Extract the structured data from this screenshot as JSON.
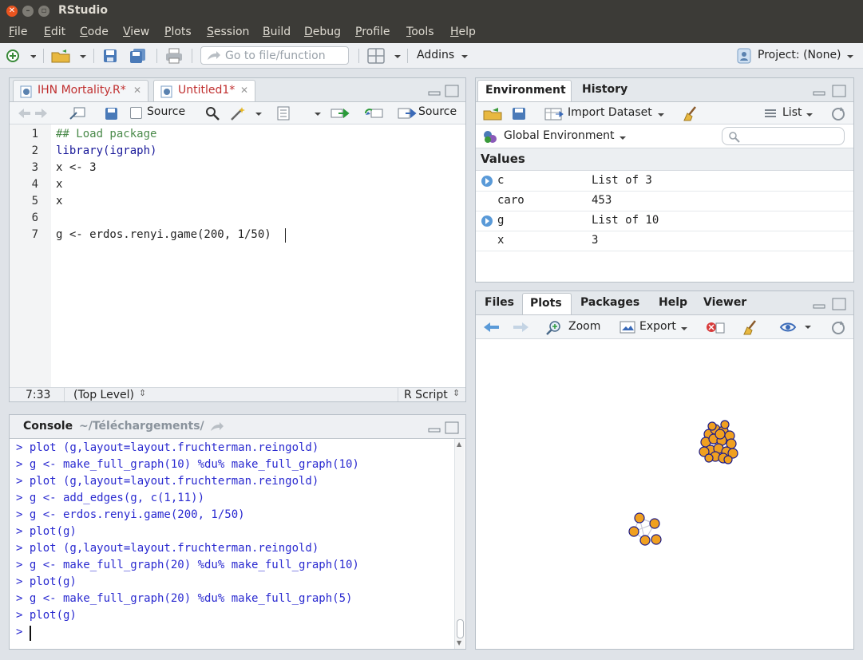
{
  "window": {
    "title": "RStudio"
  },
  "menu": [
    "File",
    "Edit",
    "Code",
    "View",
    "Plots",
    "Session",
    "Build",
    "Debug",
    "Profile",
    "Tools",
    "Help"
  ],
  "toolbar": {
    "goto_placeholder": "Go to file/function",
    "addins": "Addins",
    "project": "Project: (None)"
  },
  "editor": {
    "tabs": [
      {
        "label": "IHN Mortality.R*"
      },
      {
        "label": "Untitled1*"
      }
    ],
    "source_on_save": "Source",
    "source_button": "Source",
    "lines": [
      {
        "n": "1",
        "text": "## Load package"
      },
      {
        "n": "2",
        "text": "library(igraph)"
      },
      {
        "n": "3",
        "text": "x <- 3"
      },
      {
        "n": "4",
        "text": "x"
      },
      {
        "n": "5",
        "text": "x"
      },
      {
        "n": "6",
        "text": ""
      },
      {
        "n": "7",
        "text": "g <- erdos.renyi.game(200, 1/50)"
      }
    ],
    "status": {
      "position": "7:33",
      "scope": "(Top Level)",
      "filetype": "R Script"
    }
  },
  "console": {
    "title": "Console",
    "path": "~/Téléchargements/",
    "lines": [
      "> plot (g,layout=layout.fruchterman.reingold)",
      "> g <- make_full_graph(10) %du% make_full_graph(10)",
      "> plot (g,layout=layout.fruchterman.reingold)",
      "> g <- add_edges(g, c(1,11))",
      "> g <- erdos.renyi.game(200, 1/50)",
      "> plot(g)",
      "> plot (g,layout=layout.fruchterman.reingold)",
      "> g <- make_full_graph(20) %du% make_full_graph(10)",
      "> plot(g)",
      "> g <- make_full_graph(20) %du% make_full_graph(5)",
      "> plot(g)",
      ">"
    ]
  },
  "environment": {
    "tabs": [
      "Environment",
      "History"
    ],
    "import_dataset": "Import Dataset",
    "view_mode": "List",
    "scope": "Global Environment",
    "section": "Values",
    "rows": [
      {
        "name": "c",
        "value": "List of 3",
        "expandable": true
      },
      {
        "name": "caro",
        "value": "453",
        "expandable": false
      },
      {
        "name": "g",
        "value": "List of 10",
        "expandable": true
      },
      {
        "name": "x",
        "value": "3",
        "expandable": false
      }
    ]
  },
  "files": {
    "tabs": [
      "Files",
      "Plots",
      "Packages",
      "Help",
      "Viewer"
    ],
    "zoom": "Zoom",
    "export": "Export"
  },
  "colors": {
    "accent": "#2a2ad0",
    "node": "#f0a020",
    "node_border": "#1a1a8a",
    "comment": "#4a8a4a",
    "keyword": "#1a1a9a"
  }
}
